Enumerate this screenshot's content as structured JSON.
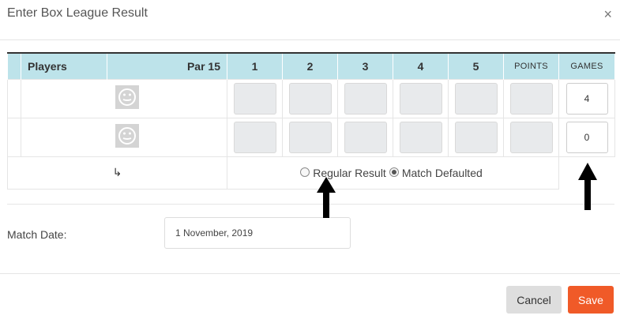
{
  "modal": {
    "title": "Enter Box League Result",
    "close_glyph": "×"
  },
  "table": {
    "headers": {
      "players": "Players",
      "par": "Par 15",
      "games": [
        "1",
        "2",
        "3",
        "4",
        "5"
      ],
      "points": "POINTS",
      "games_total": "GAMES"
    },
    "rows": [
      {
        "avatar_icon": "smiley-avatar-icon",
        "games_value": "4"
      },
      {
        "avatar_icon": "smiley-avatar-icon",
        "games_value": "0"
      }
    ],
    "result_options": {
      "arrow_glyph": "↳",
      "regular": "Regular Result",
      "defaulted": "Match Defaulted",
      "selected": "defaulted"
    }
  },
  "match_date": {
    "label": "Match Date:",
    "value": "1 November, 2019"
  },
  "footer": {
    "cancel": "Cancel",
    "save": "Save"
  },
  "colors": {
    "header_bg": "#bde3ea",
    "save": "#f05a28",
    "cancel": "#dedede",
    "annotation": "#000000"
  }
}
